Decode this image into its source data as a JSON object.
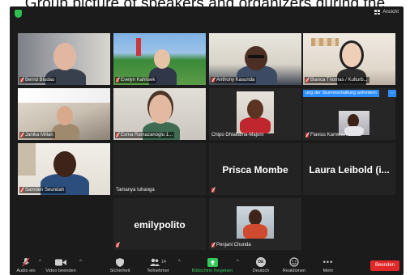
{
  "caption": "Group picture of speakers and organizers during the",
  "topbar": {
    "view_label": "Ansicht"
  },
  "tiles": [
    {
      "name": "Bernd Bludau"
    },
    {
      "name": "Evelyn Kahlisek"
    },
    {
      "name": "Anthony Kasunda"
    },
    {
      "name": "Bianca Thomas / Kulturb..."
    },
    {
      "name": "Janika Millan"
    },
    {
      "name": "Esma Ramazanoglu 1..."
    },
    {
      "name": "Chipo Dhlakama-Majoni"
    },
    {
      "name": "Flavius Kamwavi"
    },
    {
      "name": "Samden Seundah"
    },
    {
      "name": "Tamanya Iuhanga"
    },
    {
      "name": "Prisca Mombe"
    },
    {
      "name": "Laura Leibold (i..."
    },
    {
      "name": "emilypolito"
    },
    {
      "name": "Penjani Chunda"
    }
  ],
  "raise_hand_banner": "ung der Stummschaltung anfordern",
  "raise_hand_more": "...",
  "toolbar": {
    "audio": "Audio ein",
    "video": "Video beenden",
    "security": "Sicherheit",
    "participants": "Teilnehmer",
    "participants_count": "14",
    "share": "Bildschirm freigeben",
    "language": "Deutsch",
    "language_badge": "DE",
    "reactions": "Reaktionen",
    "more": "Mehr",
    "end": "Beenden"
  },
  "colors": {
    "accent_green": "#34c759",
    "end_red": "#e02828",
    "active_outline": "#b9d34a",
    "banner_blue": "#2d8cff"
  }
}
